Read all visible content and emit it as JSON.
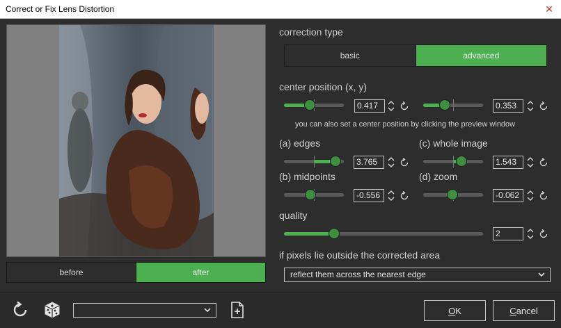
{
  "window": {
    "title": "Correct or Fix Lens Distortion",
    "close_icon": "close-icon"
  },
  "preview": {
    "toggle": [
      {
        "label": "before",
        "active": false
      },
      {
        "label": "after",
        "active": true
      }
    ]
  },
  "correction_type": {
    "label": "correction type",
    "options": [
      {
        "label": "basic",
        "active": false
      },
      {
        "label": "advanced",
        "active": true
      }
    ]
  },
  "center_position": {
    "label": "center position (x, y)",
    "x": {
      "value": "0.417"
    },
    "y": {
      "value": "0.353"
    },
    "hint": "you can also set a center position by clicking the preview window"
  },
  "edges": {
    "label": "(a) edges",
    "value": "3.765"
  },
  "whole_image": {
    "label": "(c) whole image",
    "value": "1.543"
  },
  "midpoints": {
    "label": "(b) midpoints",
    "value": "-0.556"
  },
  "zoom": {
    "label": "(d) zoom",
    "value": "-0.062"
  },
  "quality": {
    "label": "quality",
    "value": "2"
  },
  "outside": {
    "label": "if pixels lie outside the corrected area",
    "selected": "reflect them across the nearest edge"
  },
  "bottom": {
    "preset_value": "",
    "ok_prefix": "O",
    "ok_rest": "K",
    "cancel_prefix": "C",
    "cancel_rest": "ancel"
  },
  "colors": {
    "accent": "#4caf50",
    "panel": "#2d2d2d",
    "preview_bg": "#808080"
  }
}
